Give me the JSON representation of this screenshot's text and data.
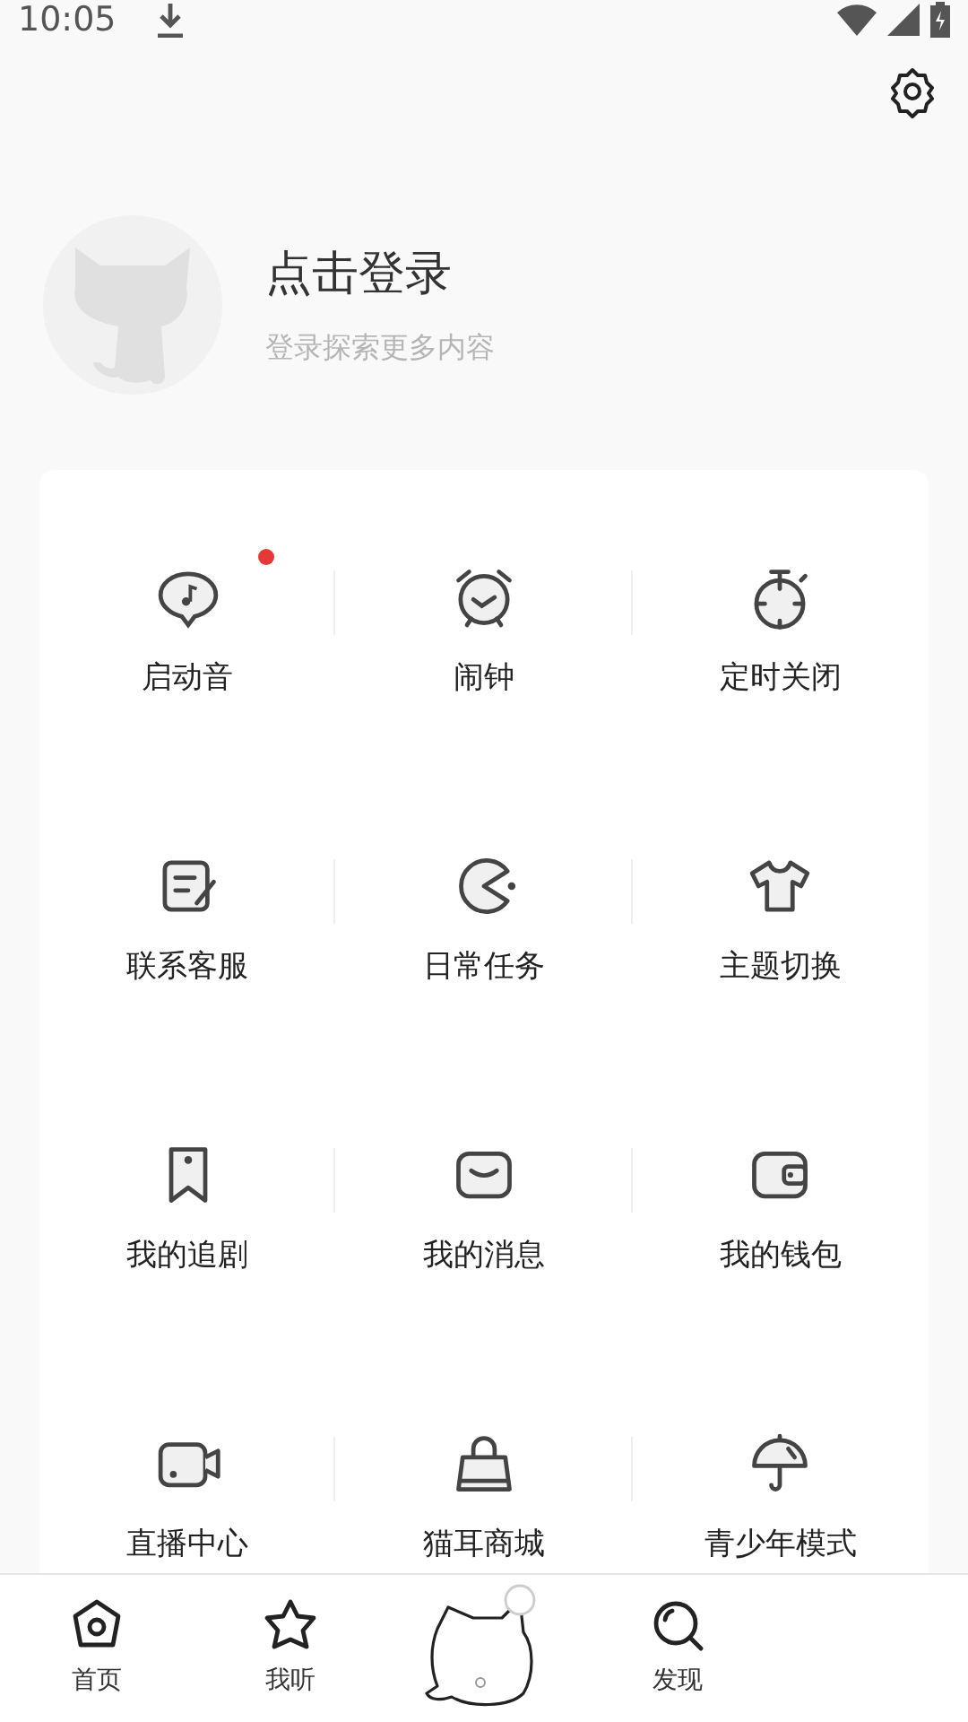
{
  "status_bar": {
    "time": "10:05"
  },
  "profile": {
    "title": "点击登录",
    "subtitle": "登录探索更多内容"
  },
  "menu": [
    {
      "label": "启动音",
      "dot": true
    },
    {
      "label": "闹钟",
      "dot": false
    },
    {
      "label": "定时关闭",
      "dot": false
    },
    {
      "label": "联系客服",
      "dot": false
    },
    {
      "label": "日常任务",
      "dot": false
    },
    {
      "label": "主题切换",
      "dot": false
    },
    {
      "label": "我的追剧",
      "dot": false
    },
    {
      "label": "我的消息",
      "dot": false
    },
    {
      "label": "我的钱包",
      "dot": false
    },
    {
      "label": "直播中心",
      "dot": false
    },
    {
      "label": "猫耳商城",
      "dot": false
    },
    {
      "label": "青少年模式",
      "dot": false
    }
  ],
  "bottom_nav": [
    {
      "label": "首页",
      "kind": "tab"
    },
    {
      "label": "我听",
      "kind": "tab"
    },
    {
      "kind": "mascot"
    },
    {
      "label": "发现",
      "kind": "tab"
    }
  ]
}
